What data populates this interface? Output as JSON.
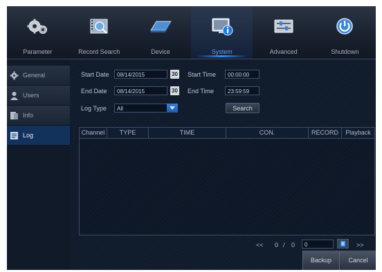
{
  "tabs": [
    {
      "label": "Parameter",
      "icon": "gears-icon"
    },
    {
      "label": "Record Search",
      "icon": "film-search-icon"
    },
    {
      "label": "Device",
      "icon": "hard-drive-icon"
    },
    {
      "label": "System",
      "icon": "system-info-icon",
      "active": true
    },
    {
      "label": "Advanced",
      "icon": "sliders-icon"
    },
    {
      "label": "Shutdown",
      "icon": "power-icon"
    }
  ],
  "sidebar": {
    "items": [
      {
        "label": "General",
        "icon": "gear-icon"
      },
      {
        "label": "Users",
        "icon": "user-icon"
      },
      {
        "label": "Info",
        "icon": "info-icon"
      },
      {
        "label": "Log",
        "icon": "log-icon",
        "active": true
      }
    ]
  },
  "form": {
    "start_date_label": "Start Date",
    "start_date_value": "08/14/2015",
    "end_date_label": "End Date",
    "end_date_value": "08/14/2015",
    "calendar_label": "30",
    "start_time_label": "Start Time",
    "start_time_value": "00:00:00",
    "end_time_label": "End Time",
    "end_time_value": "23:59:59",
    "log_type_label": "Log Type",
    "log_type_value": "All",
    "search_label": "Search"
  },
  "table": {
    "columns": [
      "Channel",
      "TYPE",
      "TIME",
      "CON.",
      "RECORD",
      "Playback"
    ],
    "rows": []
  },
  "pager": {
    "first": "<<",
    "current": "0",
    "separator": "/",
    "total": "0",
    "goto_value": "0",
    "last": ">>"
  },
  "footer": {
    "backup_label": "Backup",
    "cancel_label": "Cancel"
  },
  "colors": {
    "accent": "#2f8dff",
    "active_sidebar": "#12325c"
  }
}
